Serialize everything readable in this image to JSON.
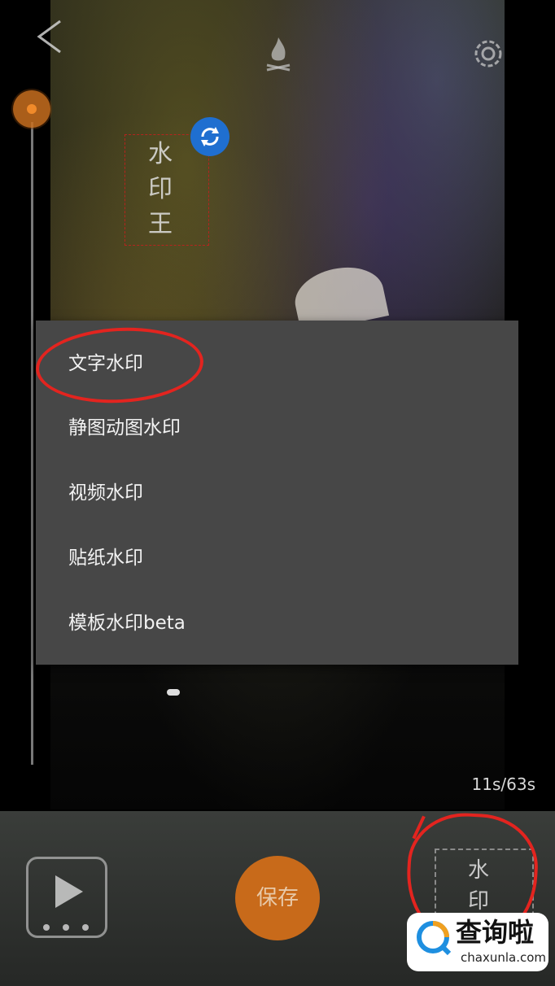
{
  "toolbar": {
    "back_icon": "chevron-left-icon",
    "center_icon": "campfire-icon",
    "settings_icon": "gear-icon"
  },
  "video": {
    "watermark_text": [
      "水",
      "印",
      "王"
    ],
    "rotate_icon": "rotate-icon"
  },
  "menu": {
    "items": [
      {
        "label": "文字水印"
      },
      {
        "label": "静图动图水印"
      },
      {
        "label": "视频水印"
      },
      {
        "label": "贴纸水印"
      },
      {
        "label": "模板水印beta"
      }
    ]
  },
  "playback": {
    "time": "11s/63s"
  },
  "bottom_bar": {
    "play_icon": "play-icon",
    "save_label": "保存",
    "watermark_button_text": [
      "水",
      "印"
    ]
  },
  "site_logo": {
    "cn": "查询啦",
    "en": "chaxunla.com"
  },
  "colors": {
    "menu_bg": "#474747",
    "accent_orange": "#c86a1a",
    "rotate_blue": "#1f6fd0",
    "annotation_red": "#e3241f"
  }
}
